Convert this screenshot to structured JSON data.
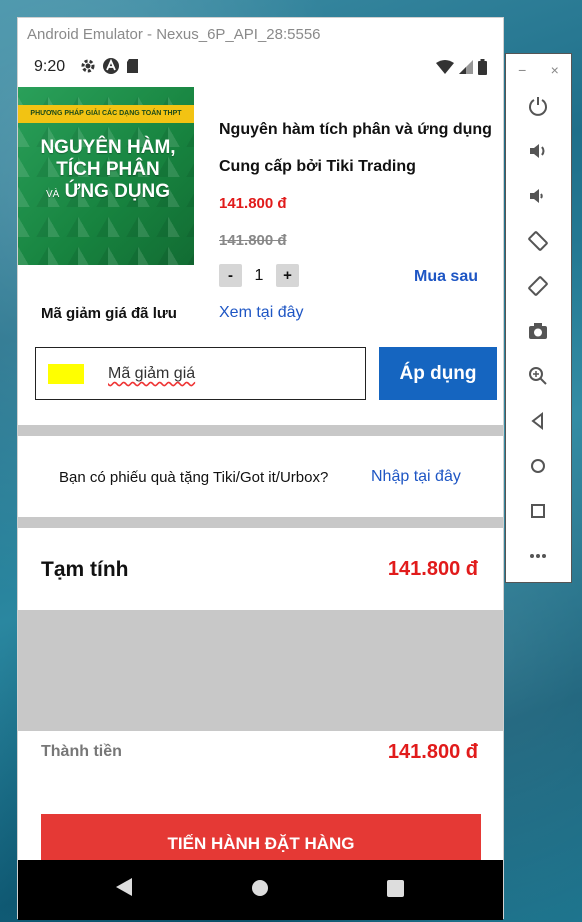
{
  "window": {
    "title": "Android Emulator - Nexus_6P_API_28:5556"
  },
  "status_bar": {
    "time": "9:20"
  },
  "product": {
    "cover_banner": "PHƯƠNG PHÁP GIẢI CÁC DẠNG TOÁN THPT",
    "cover_title_line1": "NGUYÊN HÀM,",
    "cover_title_line2": "TÍCH PHÂN",
    "cover_title_small": "VÀ",
    "cover_title_line3": "ỨNG DỤNG",
    "title": "Nguyên hàm tích phân và ứng dụng",
    "seller": "Cung cấp bởi Tiki Trading",
    "price": "141.800 đ",
    "old_price": "141.800 đ",
    "quantity": "1",
    "minus_label": "-",
    "plus_label": "+",
    "buy_later": "Mua sau"
  },
  "coupon": {
    "saved_label": "Mã giảm giá đã lưu",
    "see_link": "Xem tại đây",
    "placeholder": "Mã giảm giá",
    "apply_label": "Áp dụng",
    "swatch_color": "#ffff00"
  },
  "gift": {
    "question": "Bạn có phiếu quà tặng Tiki/Got it/Urbox?",
    "link": "Nhập tại đây"
  },
  "summary": {
    "subtotal_label": "Tạm tính",
    "subtotal_value": "141.800 đ",
    "total_label": "Thành tiền",
    "total_value": "141.800 đ"
  },
  "checkout": {
    "label": "TIẾN HÀNH ĐẶT HÀNG",
    "color": "#e53935"
  },
  "side_panel": {
    "minimize": "−",
    "close": "×",
    "buttons": [
      "power-icon",
      "volume-up-icon",
      "volume-down-icon",
      "rotate-left-icon",
      "rotate-right-icon",
      "camera-icon",
      "zoom-icon",
      "back-icon",
      "home-icon",
      "overview-icon",
      "more-icon"
    ]
  },
  "colors": {
    "accent_blue": "#1565c0",
    "link_blue": "#1e56c4",
    "price_red": "#e11b1b"
  }
}
